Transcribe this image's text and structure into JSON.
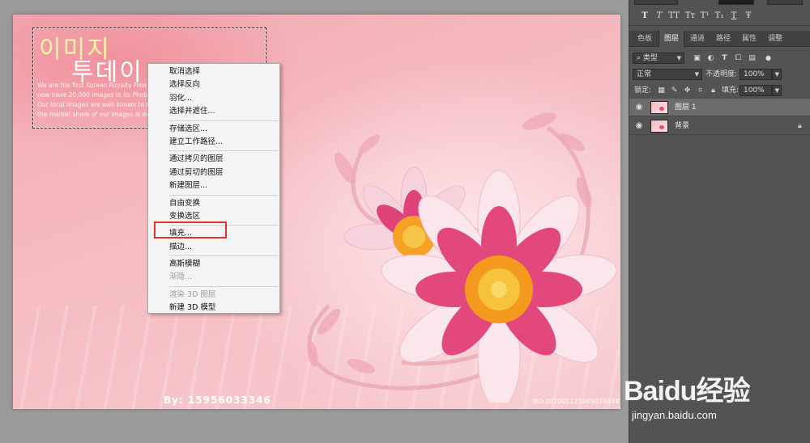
{
  "canvas": {
    "korean_line1": "이미지",
    "korean_line2": "투데이",
    "intro_lines": [
      "We are the first Korean Royalty Free image",
      "now have 20,000 images in its Photoleader",
      "Our local images are well known to Korean",
      "the market share of our images is over 70 p"
    ],
    "signature": "By: 15956033346",
    "serial": "NO:20100112100907644915"
  },
  "context_menu": {
    "groups": [
      [
        "取消选择",
        "选择反向",
        "羽化...",
        "选择并遮住..."
      ],
      [
        "存储选区...",
        "建立工作路径..."
      ],
      [
        "通过拷贝的图层",
        "通过剪切的图层",
        "新建图层..."
      ],
      [
        "自由变换",
        "变换选区"
      ],
      [
        "填充...",
        "描边..."
      ],
      [
        "高斯模糊",
        "渐隐..."
      ],
      [
        "渲染 3D 图层",
        "新建 3D 模型"
      ]
    ],
    "disabled": [
      "渐隐...",
      "渲染 3D 图层"
    ],
    "highlighted": "填充..."
  },
  "panel": {
    "type_buttons": [
      "T",
      "T",
      "TT",
      "Tт",
      "T¹",
      "T₁",
      "T",
      "Ŧ"
    ],
    "tabs": [
      "色板",
      "图层",
      "通道",
      "路径",
      "属性",
      "调整"
    ],
    "active_tab": "图层",
    "filter_kind": "类型",
    "blend_mode": "正常",
    "opacity_label": "不透明度:",
    "opacity_value": "100%",
    "lock_label": "锁定:",
    "fill_label": "填充:",
    "fill_value": "100%",
    "layers": [
      {
        "name": "图层 1",
        "selected": true,
        "locked": false
      },
      {
        "name": "背景",
        "selected": false,
        "locked": true
      }
    ]
  },
  "watermark": {
    "brand": "Baidu经验",
    "url": "jingyan.baidu.com"
  },
  "colors": {
    "highlight_box": "#e63131",
    "panel_bg": "#535353",
    "canvas_pink": "#f5bcc2"
  }
}
